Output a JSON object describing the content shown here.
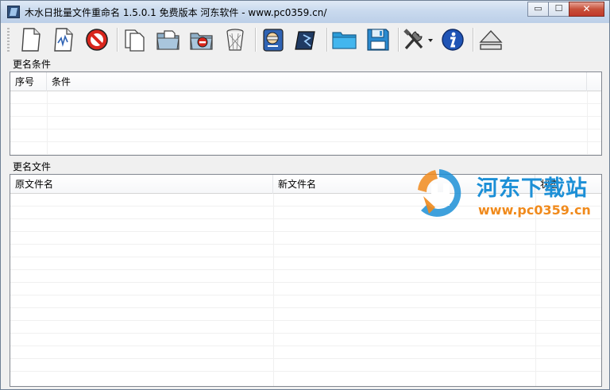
{
  "window": {
    "title": "木水日批量文件重命名 1.5.0.1 免费版本 河东软件 - www.pc0359.cn/",
    "controls": {
      "minimize": "▭",
      "maximize": "☐",
      "close": "✕"
    }
  },
  "toolbar": {
    "buttons": [
      {
        "name": "new-file-icon"
      },
      {
        "name": "edit-file-icon"
      },
      {
        "name": "stop-icon"
      },
      {
        "name": "copy-pages-icon"
      },
      {
        "name": "add-to-folder-icon"
      },
      {
        "name": "remove-from-folder-icon"
      },
      {
        "name": "trash-icon"
      },
      {
        "name": "preview-icon"
      },
      {
        "name": "execute-icon"
      },
      {
        "name": "open-folder-icon"
      },
      {
        "name": "save-disk-icon"
      },
      {
        "name": "tools-icon"
      },
      {
        "name": "info-icon"
      },
      {
        "name": "eject-icon"
      }
    ]
  },
  "conditions": {
    "group_label": "更名条件",
    "columns": [
      "序号",
      "条件"
    ]
  },
  "files": {
    "group_label": "更名文件",
    "columns": [
      "原文件名",
      "新文件名",
      "状态"
    ]
  },
  "watermark": {
    "title": "河东下载站",
    "url": "www.pc0359.cn"
  },
  "colors": {
    "title_bar": "#c9daee",
    "close_button": "#c7503a",
    "watermark_blue": "#1c8fd6",
    "watermark_orange": "#f08a1c"
  }
}
